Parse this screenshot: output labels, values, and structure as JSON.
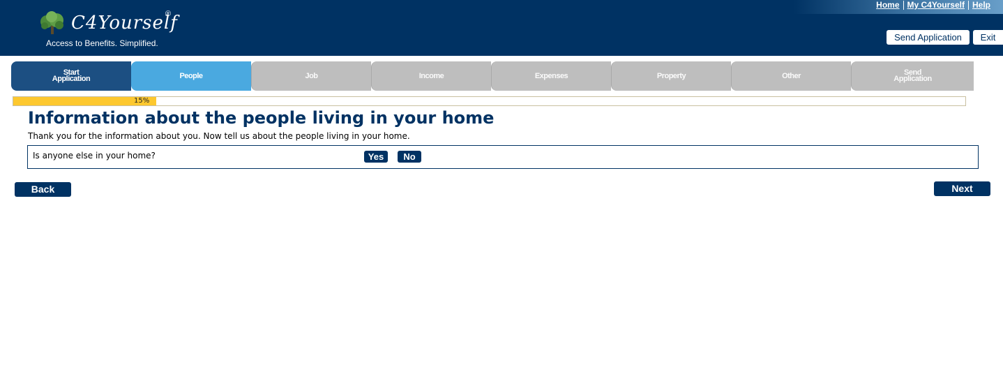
{
  "header": {
    "brand": "C4Yourself",
    "registered": "®",
    "tagline": "Access to Benefits.  Simplified.",
    "links": [
      "Home",
      "My C4Yourself",
      "Help"
    ],
    "send_application_label": "Send Application",
    "exit_label": "Exit",
    "colors": {
      "navy": "#003263",
      "white": "#ffffff"
    }
  },
  "steps": [
    {
      "label_line1": "Start",
      "label_line2": "Application",
      "state": "done"
    },
    {
      "label_line1": "People",
      "label_line2": "",
      "state": "current"
    },
    {
      "label_line1": "Job",
      "label_line2": "",
      "state": "future"
    },
    {
      "label_line1": "Income",
      "label_line2": "",
      "state": "future"
    },
    {
      "label_line1": "Expenses",
      "label_line2": "",
      "state": "future"
    },
    {
      "label_line1": "Property",
      "label_line2": "",
      "state": "future"
    },
    {
      "label_line1": "Other",
      "label_line2": "",
      "state": "future"
    },
    {
      "label_line1": "Send",
      "label_line2": "Application",
      "state": "future"
    }
  ],
  "progress": {
    "value": 0.15,
    "label": "15%",
    "color": "#fdc82f"
  },
  "main": {
    "title": "Information about the people living in your home",
    "intro": "Thank you for the information about you. Now tell us about the people living in your home.",
    "question": "Is anyone else in your home?",
    "yes_label": "Yes",
    "no_label": "No"
  },
  "footer": {
    "back_label": "Back",
    "next_label": "Next"
  }
}
